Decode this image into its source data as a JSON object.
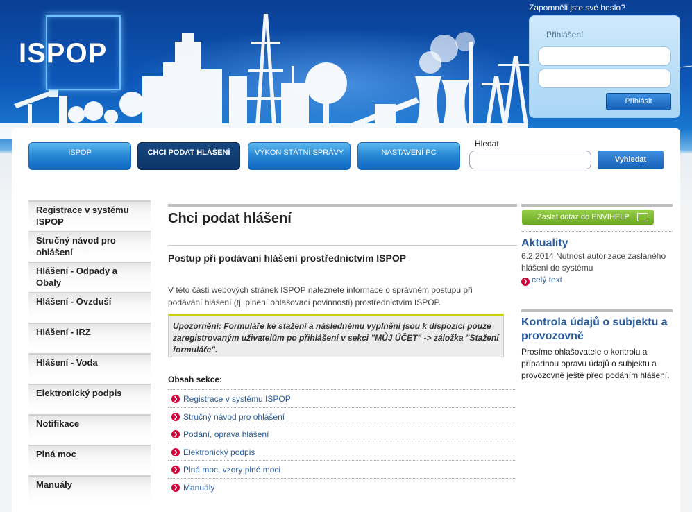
{
  "header": {
    "logo_text": "ISPOP",
    "forgot_password": "Zapomněli jste své heslo?"
  },
  "login": {
    "title": "Přihlášení",
    "submit_label": "Přihlásit"
  },
  "nav": {
    "items": [
      {
        "label": "ISPOP"
      },
      {
        "label": "CHCI PODAT HLÁŠENÍ"
      },
      {
        "label": "VÝKON STÁTNÍ SPRÁVY"
      },
      {
        "label": "NASTAVENÍ PC"
      }
    ],
    "active_index": 1
  },
  "search": {
    "label": "Hledat",
    "button_label": "Vyhledat"
  },
  "sidebar": {
    "items": [
      {
        "label": "Registrace v systému ISPOP"
      },
      {
        "label": "Stručný návod pro ohlášení"
      },
      {
        "label": "Hlášení - Odpady a Obaly"
      },
      {
        "label": "Hlášení - Ovzduší"
      },
      {
        "label": "Hlášení - IRZ"
      },
      {
        "label": "Hlášení - Voda"
      },
      {
        "label": "Elektronický podpis"
      },
      {
        "label": "Notifikace"
      },
      {
        "label": "Plná moc"
      },
      {
        "label": "Manuály"
      }
    ]
  },
  "main": {
    "title": "Chci podat hlášení",
    "subtitle": "Postup při podávaní hlášení prostřednictvím ISPOP",
    "intro": "V této části webových stránek ISPOP naleznete informace o správném postupu při podávání hlášení (tj. plnění ohlašovací povinnosti) prostřednictvím ISPOP.",
    "warning": "Upozornění: Formuláře ke stažení a následnému vyplnění jsou k dispozici pouze zaregistrovaným uživatelům po přihlášení v sekci \"MŮJ ÚČET\" -> záložka \"Stažení formuláře\".",
    "contents_heading": "Obsah sekce:",
    "contents": [
      {
        "label": "Registrace v systému ISPOP"
      },
      {
        "label": "Stručný návod pro ohlášení"
      },
      {
        "label": "Podání, oprava hlášení"
      },
      {
        "label": "Elektronický podpis"
      },
      {
        "label": "Plná moc, vzory plné moci"
      },
      {
        "label": "Manuály"
      }
    ]
  },
  "right": {
    "envihelp_label": "Zaslat dotaz do ENVIHELP",
    "news": {
      "heading": "Aktuality",
      "text": "6.2.2014 Nutnost autorizace zaslaného hlášení do systému",
      "more": "celý text"
    },
    "control": {
      "heading": "Kontrola údajů o subjektu a provozovně",
      "text": "Prosíme ohlašovatele o kontrolu a případnou opravu údajů o subjektu a provozovně ještě před podáním hlášení."
    }
  },
  "icons": {
    "bullet": "chevron-right-icon",
    "envihelp": "message-icon"
  }
}
